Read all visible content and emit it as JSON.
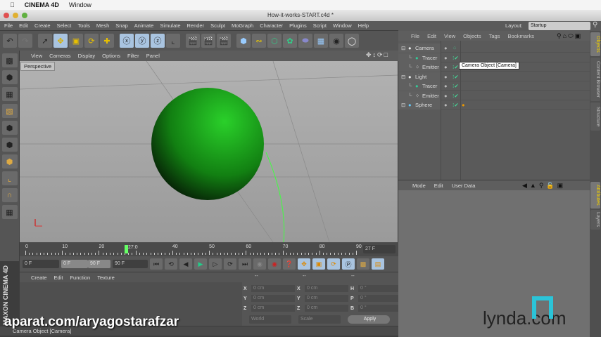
{
  "mac_menu": {
    "app": "CINEMA 4D",
    "items": [
      "Window"
    ]
  },
  "window": {
    "title": "How-it-works-START.c4d *"
  },
  "menubar": [
    "File",
    "Edit",
    "Create",
    "Select",
    "Tools",
    "Mesh",
    "Snap",
    "Animate",
    "Simulate",
    "Render",
    "Sculpt",
    "MoGraph",
    "Character",
    "Plugins",
    "Script",
    "Window",
    "Help"
  ],
  "layout": {
    "label": "Layout:",
    "value": "Startup"
  },
  "viewport": {
    "menu": [
      "View",
      "Cameras",
      "Display",
      "Options",
      "Filter",
      "Panel"
    ],
    "label": "Perspective"
  },
  "timeline": {
    "ticks": [
      "0",
      "10",
      "20",
      "40",
      "50",
      "60",
      "70",
      "80",
      "90"
    ],
    "current": "27:0",
    "current_value": 27,
    "end_field": "27 F"
  },
  "transport": {
    "start": "0 F",
    "range_start": "0 F",
    "range_end": "90 F",
    "end": "90 F"
  },
  "materials": {
    "menu": [
      "Create",
      "Edit",
      "Function",
      "Texture"
    ]
  },
  "coords": {
    "headers": [
      "--",
      "--",
      "--"
    ],
    "rows": [
      [
        "X",
        "0 cm",
        "X",
        "0 cm",
        "H",
        "0 °"
      ],
      [
        "Y",
        "0 cm",
        "Y",
        "0 cm",
        "P",
        "0 °"
      ],
      [
        "Z",
        "0 cm",
        "Z",
        "0 cm",
        "B",
        "0 °"
      ]
    ],
    "mode": "World",
    "scale": "Scale",
    "apply": "Apply"
  },
  "status": "Camera Object [Camera]",
  "objects": {
    "menu": [
      "File",
      "Edit",
      "View",
      "Objects",
      "Tags",
      "Bookmarks"
    ],
    "items": [
      {
        "name": "Camera",
        "level": 0
      },
      {
        "name": "Tracer",
        "level": 1
      },
      {
        "name": "Emitter",
        "level": 1
      },
      {
        "name": "Light",
        "level": 0
      },
      {
        "name": "Tracer",
        "level": 1
      },
      {
        "name": "Emitter",
        "level": 1
      },
      {
        "name": "Sphere",
        "level": 0
      }
    ],
    "tooltip": "Camera Object [Camera]"
  },
  "attributes": {
    "menu": [
      "Mode",
      "Edit",
      "User Data"
    ]
  },
  "right_tabs": [
    "Objects",
    "Content Browser",
    "Structure"
  ],
  "attr_tabs": [
    "Attributes",
    "Layers"
  ],
  "branding": {
    "side": "MAXON CINEMA 4D",
    "watermark": "aparat.com/aryagostarafzar",
    "lynda": "lynda.com"
  },
  "colors": {
    "accent": "#a9c4e0",
    "sphere": "#1fa01f",
    "lines": "#40ff40"
  }
}
